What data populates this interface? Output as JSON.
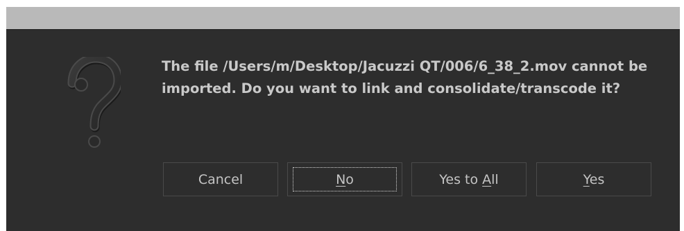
{
  "dialog": {
    "message_line1": "The file /Users/m/Desktop/Jacuzzi QT/006/6_38_2.mov cannot be",
    "message_line2": "imported. Do you want to link and consolidate/transcode it?",
    "icon": "question-mark-icon"
  },
  "buttons": {
    "cancel": {
      "label": "Cancel"
    },
    "no": {
      "mnemonic": "N",
      "rest": "o"
    },
    "yes_to_all": {
      "prefix": "Yes to ",
      "mnemonic": "A",
      "rest": "ll"
    },
    "yes": {
      "mnemonic": "Y",
      "rest": "es"
    }
  },
  "colors": {
    "dialog_background": "#2d2d2d",
    "titlebar": "#b9b9b9",
    "text": "#c9c9c9",
    "button_border": "#4a4a4a"
  }
}
